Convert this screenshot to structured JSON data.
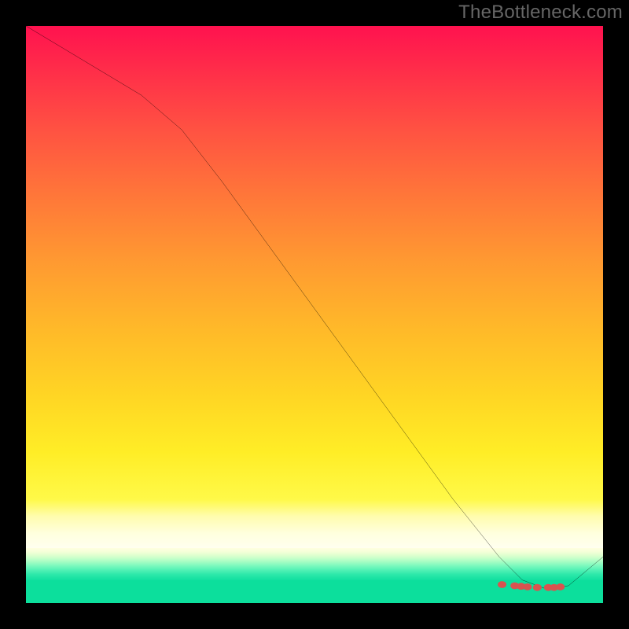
{
  "watermark": "TheBottleneck.com",
  "colors": {
    "frame": "#000000",
    "curve": "#000000",
    "marker_fill": "#d9534f",
    "gradient_top": "#ff124f",
    "gradient_mid": "#ffe824",
    "gradient_pale": "#ffffe6",
    "gradient_green": "#0cdf9c"
  },
  "chart_data": {
    "type": "line",
    "title": "",
    "xlabel": "",
    "ylabel": "",
    "xlim": [
      0,
      100
    ],
    "ylim": [
      0,
      100
    ],
    "note": "No axis ticks, labels, or legend are rendered in the image. Values below are estimated from pixel positions; y is plotted with 100 at the top and 0 at the bottom.",
    "series": [
      {
        "name": "curve",
        "x": [
          0,
          10,
          20,
          27,
          34,
          42,
          50,
          58,
          66,
          74,
          82,
          86,
          90,
          94,
          100
        ],
        "y": [
          100,
          94,
          88,
          82,
          73,
          62,
          51,
          40,
          29,
          18,
          8,
          4,
          2.5,
          3,
          8
        ]
      }
    ],
    "markers": {
      "name": "optimum-band",
      "x": [
        82.5,
        84.7,
        85.8,
        86.9,
        88.6,
        90.5,
        91.5,
        92.6
      ],
      "y": [
        3.2,
        3.0,
        2.9,
        2.8,
        2.7,
        2.7,
        2.7,
        2.8
      ]
    }
  }
}
